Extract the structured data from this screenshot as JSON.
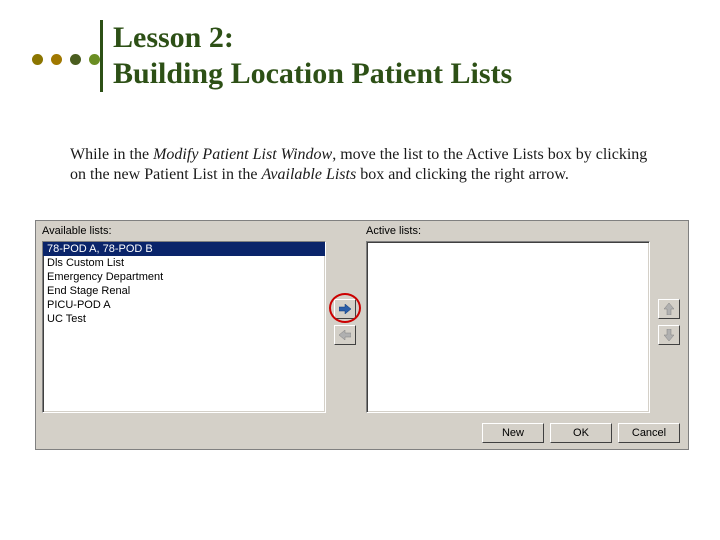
{
  "header": {
    "line1": "Lesson 2:",
    "line2": "Building Location Patient Lists"
  },
  "body": {
    "pre": "While in the ",
    "em1": "Modify Patient List Window",
    "mid": ", move the list to the Active Lists box by clicking on the new Patient List in the ",
    "em2": "Available Lists",
    "post": " box and clicking the right arrow."
  },
  "dialog": {
    "labels": {
      "available": "Available lists:",
      "active": "Active lists:"
    },
    "available_items": [
      "78-POD A, 78-POD B",
      "Dls Custom List",
      "Emergency Department",
      "End Stage Renal",
      "PICU-POD A",
      "UC Test"
    ],
    "active_items": [],
    "buttons": {
      "new": "New",
      "ok": "OK",
      "cancel": "Cancel"
    }
  }
}
